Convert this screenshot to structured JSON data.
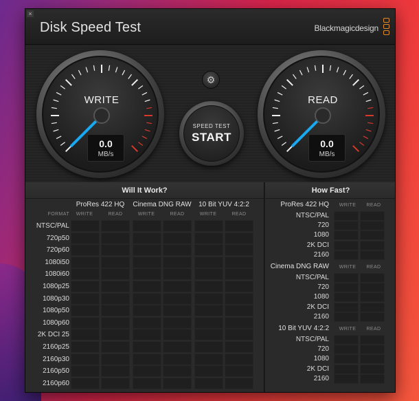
{
  "window": {
    "title": "Disk Speed Test",
    "brand": "Blackmagicdesign",
    "close_glyph": "×"
  },
  "gauges": {
    "write": {
      "label": "WRITE",
      "value": "0.0",
      "unit": "MB/s"
    },
    "read": {
      "label": "READ",
      "value": "0.0",
      "unit": "MB/s"
    }
  },
  "settings": {
    "icon": "gear-icon",
    "glyph": "⚙"
  },
  "start": {
    "small": "SPEED TEST",
    "big": "START"
  },
  "will_it_work": {
    "title": "Will It Work?",
    "format_label": "FORMAT",
    "write_label": "WRITE",
    "read_label": "READ",
    "codecs": [
      "ProRes 422 HQ",
      "Cinema DNG RAW",
      "10 Bit YUV 4:2:2"
    ],
    "formats": [
      "NTSC/PAL",
      "720p50",
      "720p60",
      "1080i50",
      "1080i60",
      "1080p25",
      "1080p30",
      "1080p50",
      "1080p60",
      "2K DCI 25",
      "2160p25",
      "2160p30",
      "2160p50",
      "2160p60"
    ]
  },
  "how_fast": {
    "title": "How Fast?",
    "write_label": "WRITE",
    "read_label": "READ",
    "sections": [
      {
        "name": "ProRes 422 HQ",
        "rows": [
          "NTSC/PAL",
          "720",
          "1080",
          "2K DCI",
          "2160"
        ]
      },
      {
        "name": "Cinema DNG RAW",
        "rows": [
          "NTSC/PAL",
          "720",
          "1080",
          "2K DCI",
          "2160"
        ]
      },
      {
        "name": "10 Bit YUV 4:2:2",
        "rows": [
          "NTSC/PAL",
          "720",
          "1080",
          "2K DCI",
          "2160"
        ]
      }
    ]
  },
  "colors": {
    "accent_orange": "#e08a2a",
    "needle": "#1aa8f0",
    "redline": "#d83a2a",
    "tick": "#f0f0f0"
  }
}
